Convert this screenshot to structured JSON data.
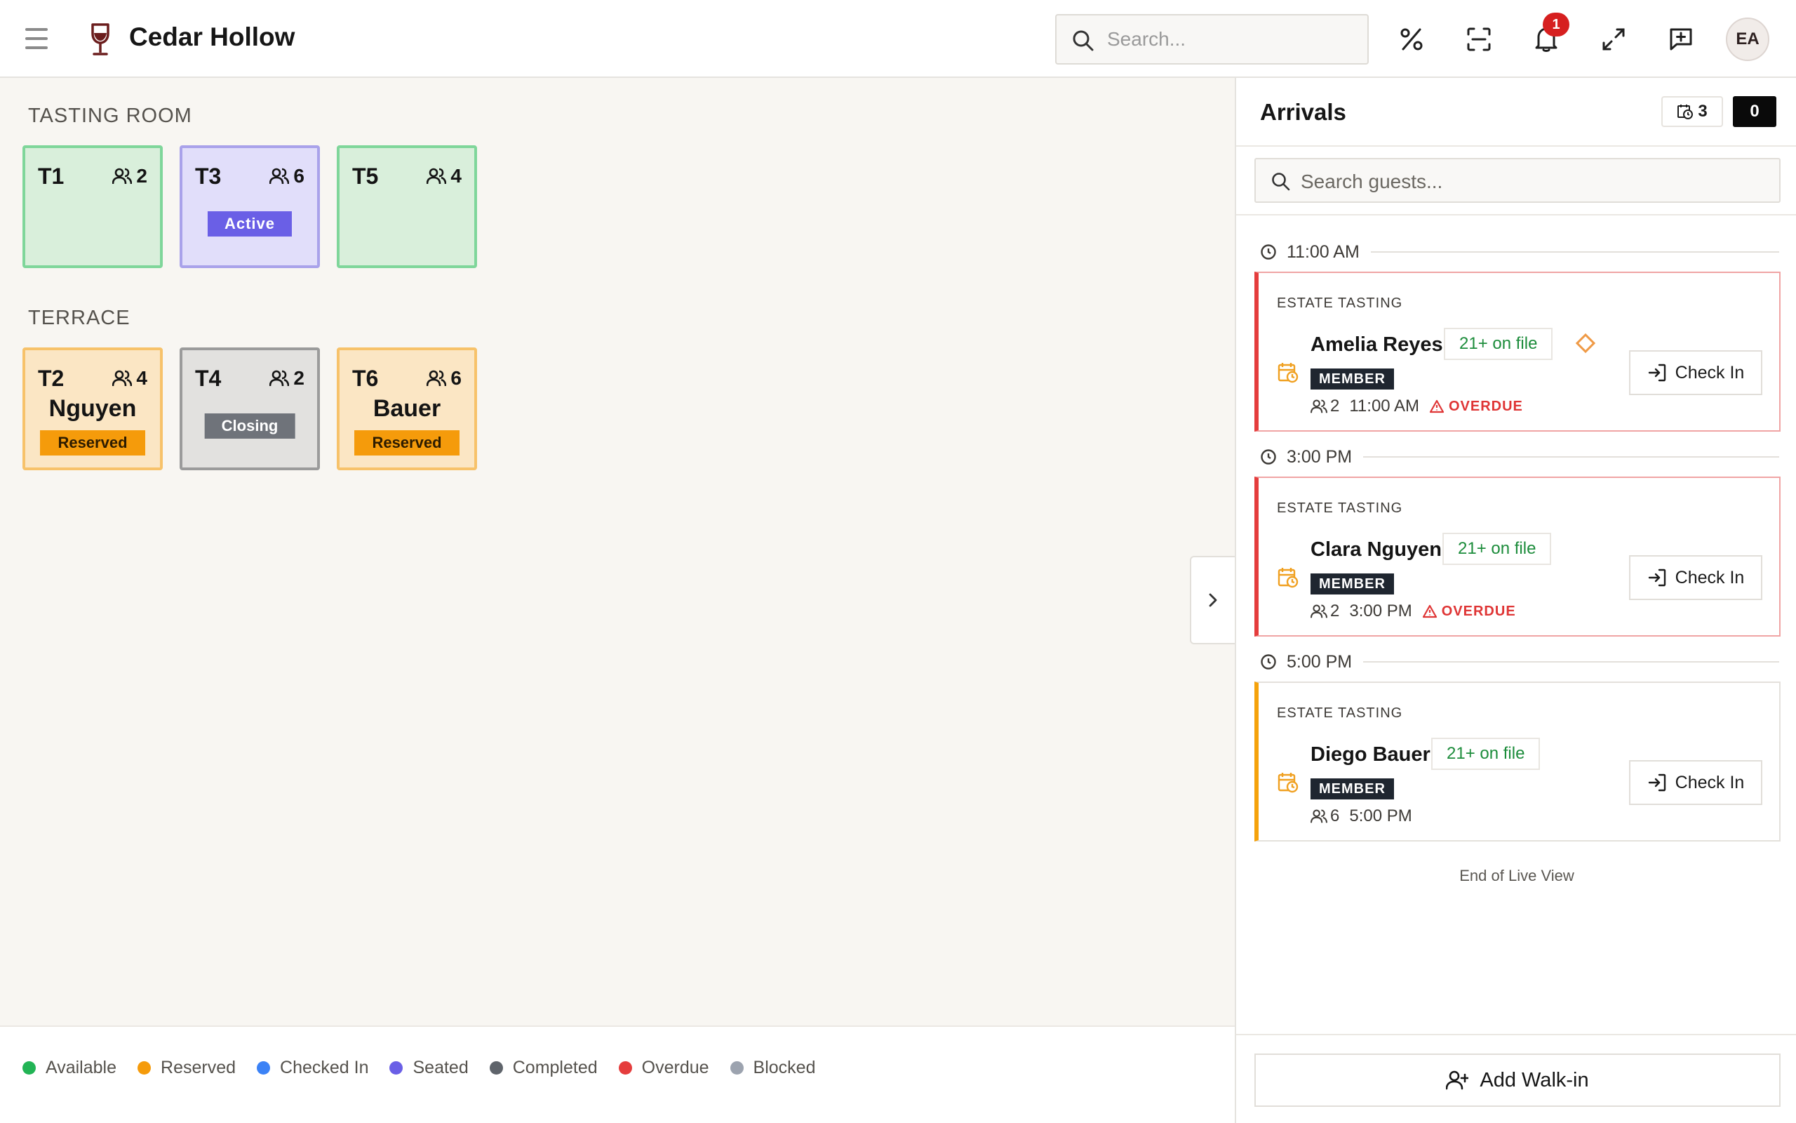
{
  "app": {
    "brand": "Cedar Hollow",
    "search_placeholder": "Search...",
    "notification_count": "1",
    "avatar_initials": "EA"
  },
  "floor": {
    "sections": [
      {
        "title": "TASTING ROOM",
        "tables": [
          {
            "name": "T1",
            "capacity": "2",
            "state": "available",
            "guest": "",
            "status": ""
          },
          {
            "name": "T3",
            "capacity": "6",
            "state": "seated",
            "guest": "",
            "status": "Active"
          },
          {
            "name": "T5",
            "capacity": "4",
            "state": "available",
            "guest": "",
            "status": ""
          }
        ]
      },
      {
        "title": "TERRACE",
        "tables": [
          {
            "name": "T2",
            "capacity": "4",
            "state": "reserved",
            "guest": "Nguyen",
            "status": "Reserved"
          },
          {
            "name": "T4",
            "capacity": "2",
            "state": "closing",
            "guest": "",
            "status": "Closing"
          },
          {
            "name": "T6",
            "capacity": "6",
            "state": "reserved",
            "guest": "Bauer",
            "status": "Reserved"
          }
        ]
      }
    ],
    "legend": [
      {
        "label": "Available",
        "color": "#22b455"
      },
      {
        "label": "Reserved",
        "color": "#f59b0b"
      },
      {
        "label": "Checked In",
        "color": "#3b82f6"
      },
      {
        "label": "Seated",
        "color": "#6a5fe6"
      },
      {
        "label": "Completed",
        "color": "#5f646b"
      },
      {
        "label": "Overdue",
        "color": "#e53d3d"
      },
      {
        "label": "Blocked",
        "color": "#9ca3af"
      }
    ]
  },
  "arrivals": {
    "title": "Arrivals",
    "count": "3",
    "dark_count": "0",
    "search_placeholder": "Search guests...",
    "groups": [
      {
        "time": "11:00 AM",
        "reservation": {
          "type": "ESTATE TASTING",
          "name": "Amelia Reyes",
          "age_chip": "21+ on file",
          "has_note_diamond": true,
          "tag": "MEMBER",
          "party": "2",
          "time": "11:00 AM",
          "overdue_label": "OVERDUE",
          "button": "Check In"
        }
      },
      {
        "time": "3:00 PM",
        "reservation": {
          "type": "ESTATE TASTING",
          "name": "Clara Nguyen",
          "age_chip": "21+ on file",
          "has_note_diamond": false,
          "tag": "MEMBER",
          "party": "2",
          "time": "3:00 PM",
          "overdue_label": "OVERDUE",
          "button": "Check In"
        }
      },
      {
        "time": "5:00 PM",
        "reservation": {
          "type": "ESTATE TASTING",
          "name": "Diego Bauer",
          "age_chip": "21+ on file",
          "has_note_diamond": false,
          "tag": "MEMBER",
          "party": "6",
          "time": "5:00 PM",
          "overdue_label": "",
          "button": "Check In"
        }
      }
    ],
    "end_label": "End of Live View",
    "walkin_label": "Add Walk-in"
  }
}
